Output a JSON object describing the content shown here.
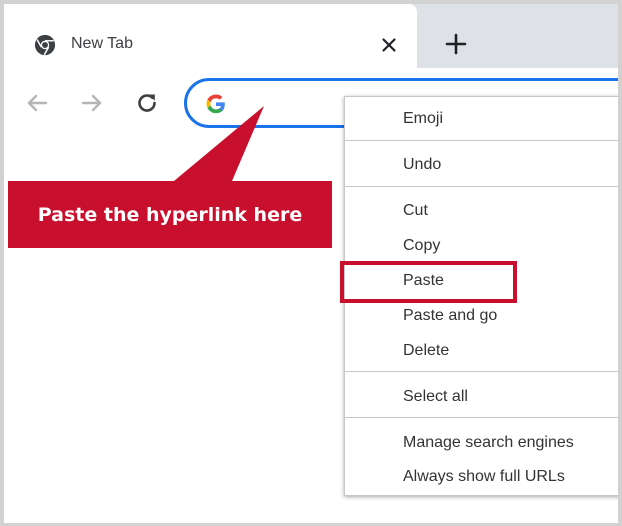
{
  "tab": {
    "title": "New Tab",
    "favicon_icon": "chrome-logo-icon",
    "close_icon": "close-icon"
  },
  "new_tab_icon": "plus-icon",
  "toolbar": {
    "back_icon": "arrow-left-icon",
    "forward_icon": "arrow-right-icon",
    "reload_icon": "reload-icon",
    "omnibox_icon": "google-g-icon",
    "omnibox_value": ""
  },
  "context_menu": {
    "items": [
      {
        "label": "Emoji"
      },
      {
        "label": "Undo"
      },
      {
        "label": "Cut"
      },
      {
        "label": "Copy"
      },
      {
        "label": "Paste"
      },
      {
        "label": "Paste and go"
      },
      {
        "label": "Delete"
      },
      {
        "label": "Select all"
      },
      {
        "label": "Manage search engines"
      },
      {
        "label": "Always show full URLs"
      }
    ]
  },
  "callout": {
    "text": "Paste the hyperlink here"
  },
  "colors": {
    "accent_blue": "#1a73e8",
    "annotation_red": "#c8102e",
    "tabstrip_gray": "#dee1e6"
  }
}
